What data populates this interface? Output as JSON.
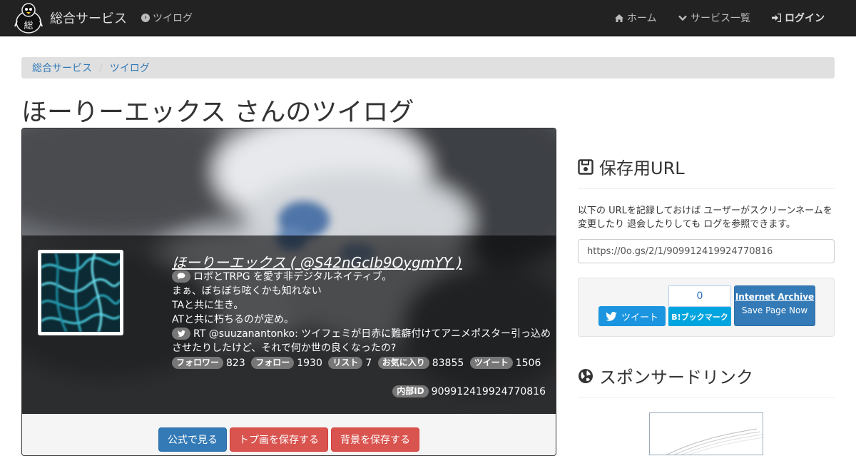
{
  "nav": {
    "brand": "総合サービス",
    "twilog": "ツイログ",
    "home": "ホーム",
    "services": "サービス一覧",
    "login": "ログイン",
    "logo_char": "総"
  },
  "breadcrumb": {
    "root": "総合サービス",
    "current": "ツイログ"
  },
  "page_title": "ほーりーエックス さんのツイログ",
  "profile": {
    "name": "ほーりーエックス ( @S42nGcIb9OygmYY )",
    "bio_lines": [
      "ロボとTRPG を愛す非デジタルネイティブ。",
      "まぁ、ぼちぼち呟くかも知れない",
      "TAと共に生き。",
      "ATと共に朽ちるのが定め。"
    ],
    "latest_tweet_line1": "RT @suuzanantonko: ツイフェミが日赤に難癖付けてアニメポスター引っ込め",
    "latest_tweet_line2": "させたりしたけど、それで何か世の良くなったの?",
    "stats": {
      "followers_label": "フォロワー",
      "followers": "823",
      "following_label": "フォロー",
      "following": "1930",
      "lists_label": "リスト",
      "lists": "7",
      "favorites_label": "お気に入り",
      "favorites": "83855",
      "tweets_label": "ツイート",
      "tweets": "1506"
    },
    "internal_id_label": "内部ID",
    "internal_id": "909912419924770816"
  },
  "actions": {
    "official": "公式で見る",
    "save_avatar": "トプ画を保存する",
    "save_banner": "背景を保存する"
  },
  "save_url": {
    "heading": "保存用URL",
    "description": "以下の URLを記録しておけば ユーザーがスクリーンネームを変更したり 退会したりしても ログを参照できます。",
    "url": "https://0o.gs/2/1/909912419924770816"
  },
  "share": {
    "tweet": "ツイート",
    "hatena_count": "0",
    "hatena_label": "B!ブックマーク",
    "ia_title": "Internet Archive",
    "ia_sub": "Save Page Now"
  },
  "sponsor": {
    "heading": "スポンサードリンク"
  }
}
